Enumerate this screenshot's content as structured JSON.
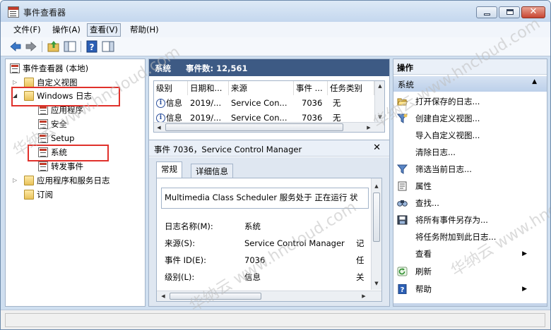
{
  "window": {
    "title": "事件查看器"
  },
  "menu": {
    "file": "文件(F)",
    "action": "操作(A)",
    "view": "查看(V)",
    "help": "帮助(H)"
  },
  "toolbar": {
    "icons": [
      "back-arrow-icon",
      "forward-arrow-icon",
      "up-folder-icon",
      "console-tree-icon",
      "help-icon",
      "action-pane-icon"
    ]
  },
  "tree": {
    "root": "事件查看器 (本地)",
    "custom_views": "自定义视图",
    "windows_logs": "Windows 日志",
    "application": "应用程序",
    "security": "安全",
    "setup": "Setup",
    "system": "系统",
    "forwarded": "转发事件",
    "apps_services": "应用程序和服务日志",
    "subscriptions": "订阅"
  },
  "log_header": {
    "name": "系统",
    "event_count": "事件数: 12,561"
  },
  "event_grid": {
    "columns": [
      "级别",
      "日期和...",
      "来源",
      "事件 ...",
      "任务类别"
    ],
    "rows": [
      {
        "level": "信息",
        "date": "2019/...",
        "source": "Service Con...",
        "event_id": "7036",
        "task": "无"
      },
      {
        "level": "信息",
        "date": "2019/...",
        "source": "Service Con...",
        "event_id": "7036",
        "task": "无"
      }
    ]
  },
  "detail": {
    "title": "事件 7036，Service Control Manager",
    "close": "✕",
    "tabs": {
      "general": "常规",
      "details": "详细信息"
    },
    "description": "Multimedia Class Scheduler 服务处于 正在运行 状",
    "fields": [
      {
        "label": "日志名称(M):",
        "value": "系统",
        "extra": ""
      },
      {
        "label": "来源(S):",
        "value": "Service Control Manager",
        "extra": "记"
      },
      {
        "label": "事件 ID(E):",
        "value": "7036",
        "extra": "任"
      },
      {
        "label": "级别(L):",
        "value": "信息",
        "extra": "关"
      }
    ]
  },
  "actions": {
    "header": "操作",
    "section": "系统",
    "items": [
      {
        "label": "打开保存的日志...",
        "icon": "open-folder-icon"
      },
      {
        "label": "创建自定义视图...",
        "icon": "filter-icon"
      },
      {
        "label": "导入自定义视图...",
        "icon": ""
      },
      {
        "label": "清除日志...",
        "icon": ""
      },
      {
        "label": "筛选当前日志...",
        "icon": "filter-icon"
      },
      {
        "label": "属性",
        "icon": "properties-icon"
      },
      {
        "label": "查找...",
        "icon": "find-icon"
      },
      {
        "label": "将所有事件另存为...",
        "icon": "save-icon"
      },
      {
        "label": "将任务附加到此日志...",
        "icon": ""
      },
      {
        "label": "查看",
        "icon": ""
      },
      {
        "label": "刷新",
        "icon": "refresh-icon"
      },
      {
        "label": "帮助",
        "icon": "help-icon"
      }
    ]
  },
  "watermark": "华纳云 www.hncloud.com",
  "colors": {
    "accent_header": "#3d5a84",
    "highlight_box": "#e0312b",
    "section_band": "#bcd0ea"
  }
}
